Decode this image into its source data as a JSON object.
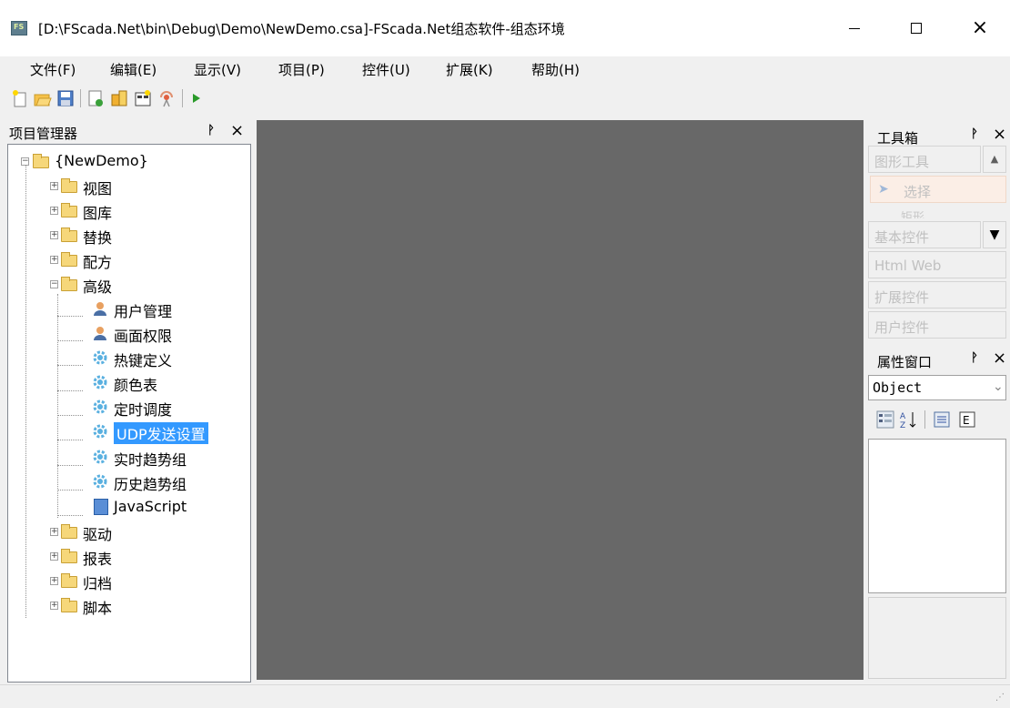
{
  "window": {
    "title": "[D:\\FScada.Net\\bin\\Debug\\Demo\\NewDemo.csa]-FScada.Net组态软件-组态环境",
    "min_icon": "minimize-icon",
    "max_icon": "maximize-icon",
    "close_label": "×"
  },
  "menu": [
    {
      "label": "文件(F)"
    },
    {
      "label": "编辑(E)"
    },
    {
      "label": "显示(V)"
    },
    {
      "label": "项目(P)"
    },
    {
      "label": "控件(U)"
    },
    {
      "label": "扩展(K)"
    },
    {
      "label": "帮助(H)"
    }
  ],
  "toolbar": {
    "icons": [
      "new-file-icon",
      "open-folder-icon",
      "save-icon",
      "new-page-icon",
      "component-icon",
      "build-icon",
      "broadcast-icon",
      "run-icon"
    ]
  },
  "project_panel": {
    "title": "项目管理器",
    "pin": "ᚹ",
    "close": "×",
    "root": "{NewDemo}",
    "nodes": [
      {
        "label": "视图"
      },
      {
        "label": "图库"
      },
      {
        "label": "替换"
      },
      {
        "label": "配方"
      },
      {
        "label": "高级"
      },
      {
        "label": "用户管理"
      },
      {
        "label": "画面权限"
      },
      {
        "label": "热键定义"
      },
      {
        "label": "颜色表"
      },
      {
        "label": "定时调度"
      },
      {
        "label": "UDP发送设置"
      },
      {
        "label": "实时趋势组"
      },
      {
        "label": "历史趋势组"
      },
      {
        "label": "JavaScript"
      },
      {
        "label": "驱动"
      },
      {
        "label": "报表"
      },
      {
        "label": "归档"
      },
      {
        "label": "脚本"
      }
    ]
  },
  "toolbox": {
    "title": "工具箱",
    "pin": "ᚹ",
    "close": "×",
    "categories": [
      {
        "label": "图形工具"
      },
      {
        "label": "选择"
      },
      {
        "label": "矩形"
      },
      {
        "label": "基本控件"
      },
      {
        "label": "Html Web"
      },
      {
        "label": "扩展控件"
      },
      {
        "label": "用户控件"
      }
    ]
  },
  "properties": {
    "title": "属性窗口",
    "pin": "ᚹ",
    "close": "×",
    "object": "Object"
  }
}
